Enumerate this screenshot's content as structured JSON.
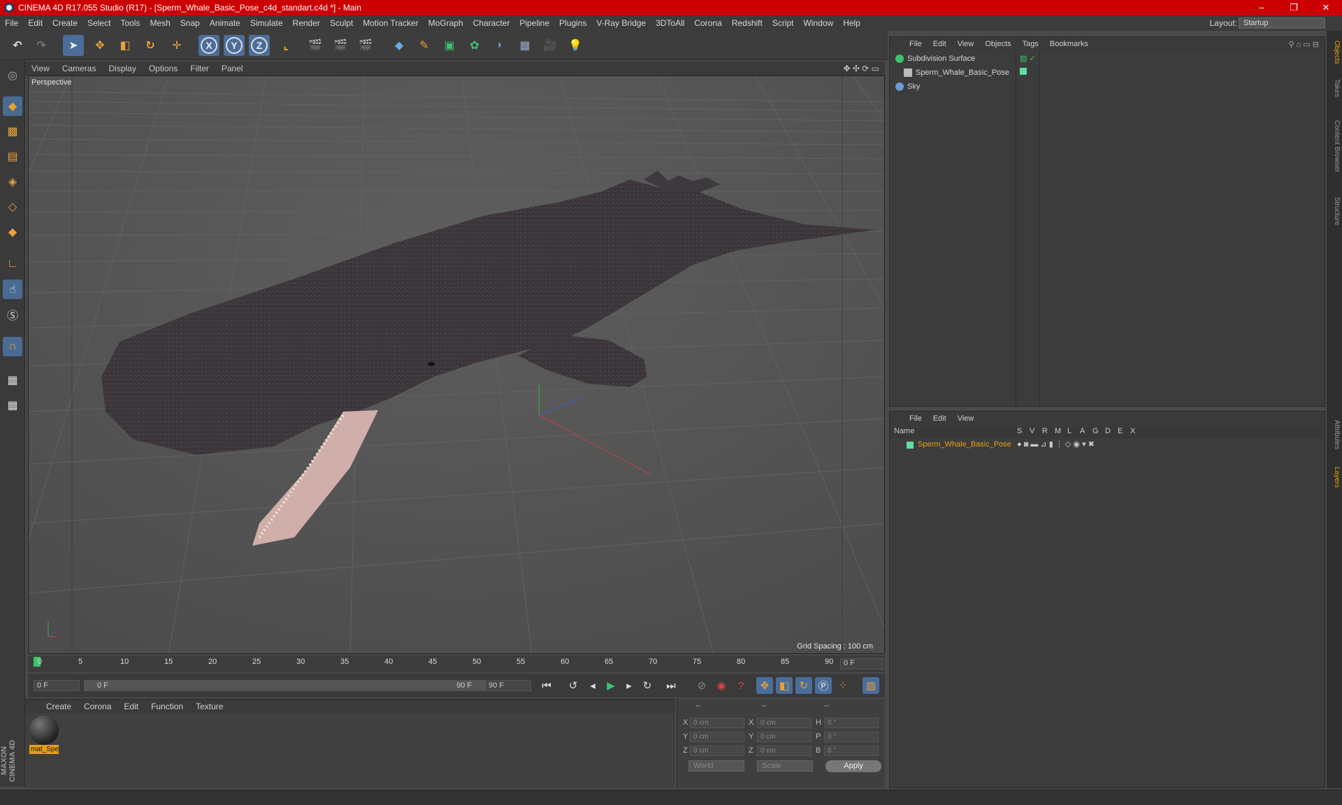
{
  "window": {
    "title": "CINEMA 4D R17.055 Studio (R17) - [Sperm_Whale_Basic_Pose_c4d_standart.c4d *] - Main",
    "buttons": [
      "–",
      "❐",
      "✕"
    ]
  },
  "menubar": {
    "items": [
      "File",
      "Edit",
      "Create",
      "Select",
      "Tools",
      "Mesh",
      "Snap",
      "Animate",
      "Simulate",
      "Render",
      "Sculpt",
      "Motion Tracker",
      "MoGraph",
      "Character",
      "Pipeline",
      "Plugins",
      "V-Ray Bridge",
      "3DToAll",
      "Corona",
      "Redshift",
      "Script",
      "Window",
      "Help"
    ],
    "layout_label": "Layout:",
    "layout_value": "Startup"
  },
  "viewport": {
    "menu": [
      "View",
      "Cameras",
      "Display",
      "Options",
      "Filter",
      "Panel"
    ],
    "camera_label": "Perspective",
    "grid_spacing": "Grid Spacing : 100 cm"
  },
  "timeline": {
    "ticks": [
      "0",
      "5",
      "10",
      "15",
      "20",
      "25",
      "30",
      "35",
      "40",
      "45",
      "50",
      "55",
      "60",
      "65",
      "70",
      "75",
      "80",
      "85",
      "90"
    ],
    "current_frame_field": "0 F",
    "start_field": "0 F",
    "range_start": "0 F",
    "range_end": "90 F",
    "end_field": "90 F"
  },
  "material_manager": {
    "menu": [
      "Create",
      "Corona",
      "Edit",
      "Function",
      "Texture"
    ],
    "material_name": "mat_Spe"
  },
  "coordinates": {
    "headers": [
      "--",
      "--",
      "--"
    ],
    "rows": [
      {
        "a": "X",
        "av": "0 cm",
        "b": "X",
        "bv": "0 cm",
        "c": "H",
        "cv": "0 °"
      },
      {
        "a": "Y",
        "av": "0 cm",
        "b": "Y",
        "bv": "0 cm",
        "c": "P",
        "cv": "0 °"
      },
      {
        "a": "Z",
        "av": "0 cm",
        "b": "Z",
        "bv": "0 cm",
        "c": "B",
        "cv": "0 °"
      }
    ],
    "world": "World",
    "scale": "Scale",
    "apply": "Apply"
  },
  "object_manager": {
    "menu": [
      "File",
      "Edit",
      "View",
      "Objects",
      "Tags",
      "Bookmarks"
    ],
    "objects": [
      {
        "name": "Subdivision Surface",
        "color": "#39c46a"
      },
      {
        "name": "Sperm_Whale_Basic_Pose",
        "color": "#bbbbbb"
      },
      {
        "name": "Sky",
        "color": "#6a9bd8"
      }
    ]
  },
  "layer_manager": {
    "menu": [
      "File",
      "Edit",
      "View"
    ],
    "columns": [
      "Name",
      "S",
      "V",
      "R",
      "M",
      "L",
      "A",
      "G",
      "D",
      "E",
      "X"
    ],
    "layer_name": "Sperm_Whale_Basic_Pose"
  },
  "right_tabs": [
    "Objects",
    "Takes",
    "Content Browser",
    "Structure",
    "Attributes",
    "Layers"
  ],
  "branding": "MAXON CINEMA 4D",
  "accent_color": "#cc0000",
  "highlight_color": "#e8a010"
}
